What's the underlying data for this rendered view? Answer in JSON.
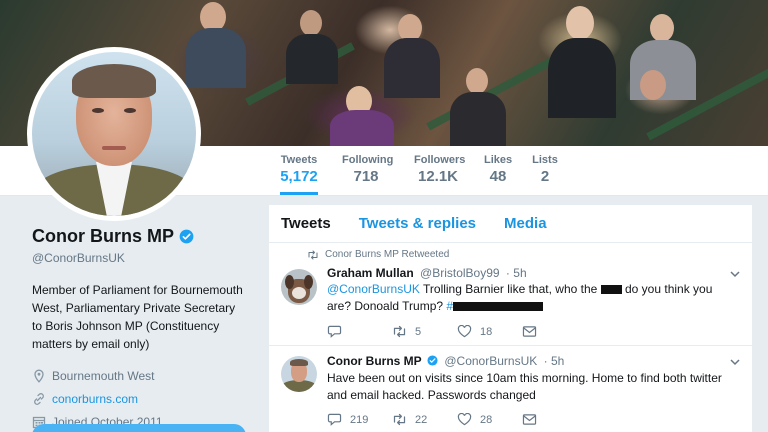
{
  "profile": {
    "name": "Conor Burns MP",
    "handle": "@ConorBurnsUK",
    "bio": "Member of Parliament for Bournemouth West, Parliamentary Private Secretary to Boris Johnson MP (Constituency matters by email only)",
    "location": "Bournemouth West",
    "website": "conorburns.com",
    "joined": "Joined October 2011"
  },
  "stats": [
    {
      "label": "Tweets",
      "value": "5,172"
    },
    {
      "label": "Following",
      "value": "718"
    },
    {
      "label": "Followers",
      "value": "12.1K"
    },
    {
      "label": "Likes",
      "value": "48"
    },
    {
      "label": "Lists",
      "value": "2"
    }
  ],
  "tabs": [
    "Tweets",
    "Tweets & replies",
    "Media"
  ],
  "tweets": [
    {
      "retweet_notice": "Conor Burns MP Retweeted",
      "name": "Graham Mullan",
      "handle": "@BristolBoy99",
      "time": "5h",
      "mention": "@ConorBurnsUK",
      "text_part1": " Trolling Barnier like that, who the ",
      "text_part2": " do you think you are? Donoald Trump? ",
      "hashtag": "#",
      "replies": "",
      "retweets": "5",
      "likes": "18"
    },
    {
      "name": "Conor Burns MP",
      "handle": "@ConorBurnsUK",
      "time": "5h",
      "text": "Have been out on visits since 10am this morning. Home to find both twitter and email hacked. Passwords changed",
      "replies": "219",
      "retweets": "22",
      "likes": "28"
    }
  ],
  "colors": {
    "accent": "#1da1f2",
    "link": "#1b95e0",
    "text": "#14171a",
    "muted": "#657786",
    "background": "#e6ecf0"
  }
}
